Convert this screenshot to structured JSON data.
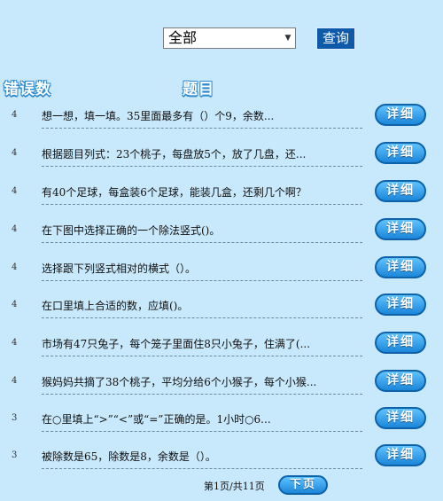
{
  "filter": {
    "selected": "全部",
    "arrow_icon": "chevron-down-icon"
  },
  "query_button": "查询",
  "headers": {
    "error_count": "错误数",
    "question": "题目"
  },
  "detail_label": "详细",
  "rows": [
    {
      "count": "4",
      "question": "想一想，填一填。35里面最多有（）个9，余数..."
    },
    {
      "count": "4",
      "question": "根据题目列式：23个桃子，每盘放5个，放了几盘，还..."
    },
    {
      "count": "4",
      "question": "有40个足球，每盒装6个足球，能装几盒，还剩几个啊？"
    },
    {
      "count": "4",
      "question": "在下图中选择正确的一个除法竖式()。"
    },
    {
      "count": "4",
      "question": "选择跟下列竖式相对的横式（）。"
    },
    {
      "count": "4",
      "question": "在口里填上合适的数，应填()。"
    },
    {
      "count": "4",
      "question": "市场有47只兔子，每个笼子里面住8只小兔子，住满了(..."
    },
    {
      "count": "4",
      "question": "猴妈妈共摘了38个桃子，平均分给6个小猴子，每个小猴..."
    },
    {
      "count": "3",
      "question": "在○里填上“>”“<”或“=”正确的是。1小时○6..."
    },
    {
      "count": "3",
      "question": "被除数是65，除数是8，余数是（）。"
    }
  ],
  "pager": {
    "text": "第1页/共11页",
    "next_label": "下页"
  }
}
